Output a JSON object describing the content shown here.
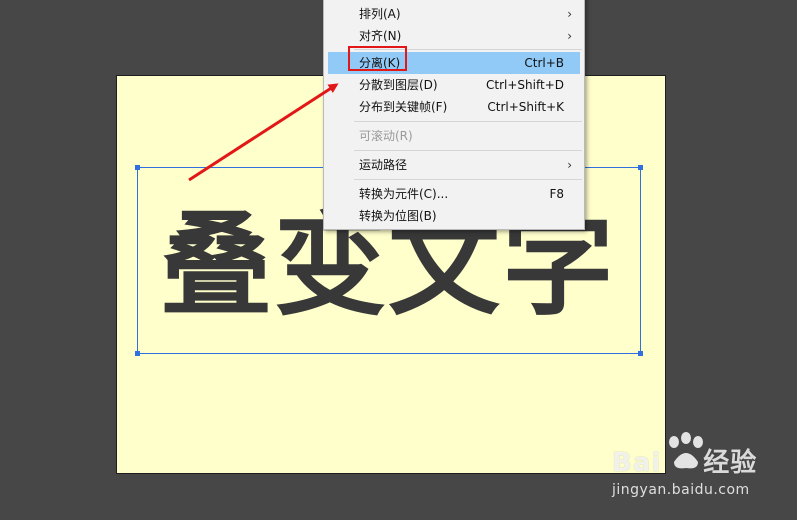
{
  "canvas_text": "叠变文字",
  "menu": {
    "items": [
      {
        "label": "排列(A)",
        "submenu": true
      },
      {
        "label": "对齐(N)",
        "submenu": true
      },
      {
        "label": "分离(K)",
        "shortcut": "Ctrl+B",
        "highlighted": true
      },
      {
        "label": "分散到图层(D)",
        "shortcut": "Ctrl+Shift+D"
      },
      {
        "label": "分布到关键帧(F)",
        "shortcut": "Ctrl+Shift+K"
      },
      {
        "label": "可滚动(R)",
        "disabled": true
      },
      {
        "label": "运动路径",
        "submenu": true
      },
      {
        "label": "转换为元件(C)...",
        "shortcut": "F8"
      },
      {
        "label": "转换为位图(B)"
      }
    ]
  },
  "watermark": {
    "brand_left": "Bai",
    "brand_right": "经验",
    "site": "jingyan.baidu.com"
  },
  "colors": {
    "background": "#474747",
    "stage": "#ffffcc",
    "selection": "#2f6fe0",
    "highlight": "#91c9f7",
    "annotation": "#e21818"
  }
}
